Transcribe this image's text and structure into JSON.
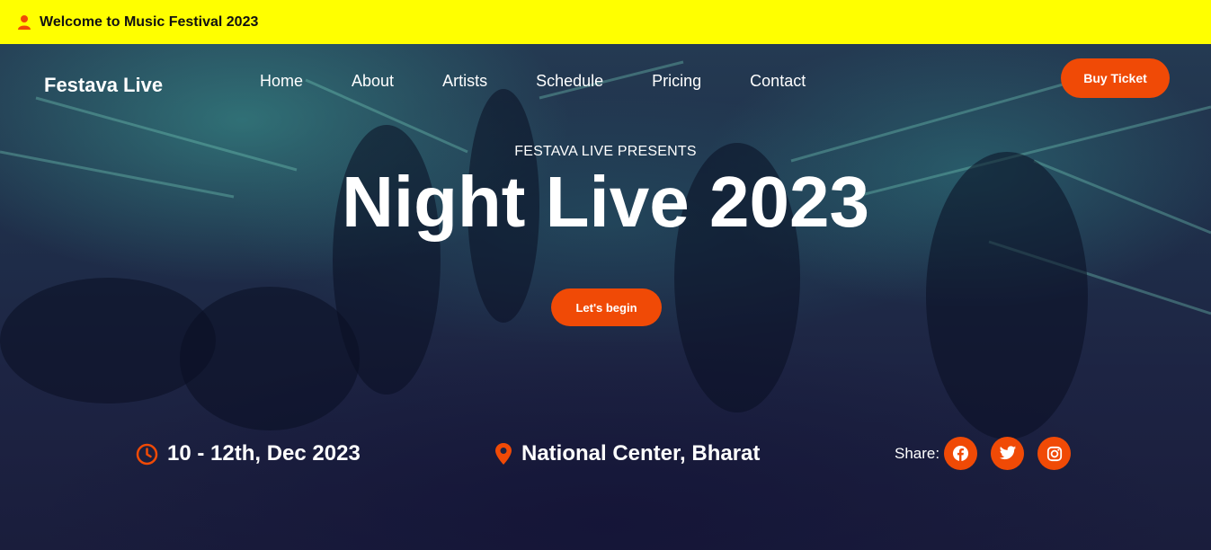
{
  "topbar": {
    "welcome": "Welcome to Music Festival 2023",
    "icon": "user-icon",
    "bg": "#ffff00"
  },
  "header": {
    "brand": "Festava Live",
    "nav": [
      "Home",
      "About",
      "Artists",
      "Schedule",
      "Pricing",
      "Contact"
    ],
    "buy_label": "Buy Ticket"
  },
  "hero": {
    "presents": "FESTAVA LIVE PRESENTS",
    "title": "Night Live 2023",
    "cta_label": "Let's begin"
  },
  "event": {
    "date": "10 - 12th, Dec 2023",
    "date_icon": "clock-icon",
    "location": "National Center, Bharat",
    "location_icon": "map-pin-icon"
  },
  "share": {
    "label": "Share:",
    "networks": [
      "facebook-icon",
      "twitter-icon",
      "instagram-icon"
    ]
  },
  "colors": {
    "accent": "#f04a06",
    "text": "#ffffff",
    "topbar": "#ffff00"
  }
}
